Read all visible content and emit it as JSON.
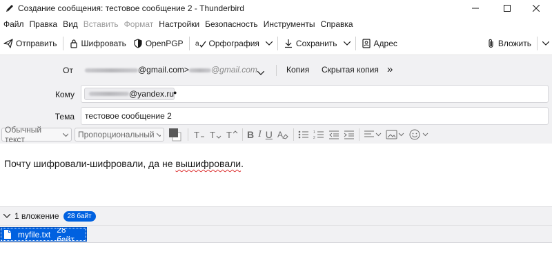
{
  "window": {
    "title": "Создание сообщения: тестовое сообщение 2 - Thunderbird",
    "icon": "pencil-icon"
  },
  "menu": [
    "Файл",
    "Правка",
    "Вид",
    "Вставить",
    "Формат",
    "Настройки",
    "Безопасность",
    "Инструменты",
    "Справка"
  ],
  "menu_disabled": [
    "Вставить",
    "Формат"
  ],
  "toolbar": {
    "send": "Отправить",
    "encrypt": "Шифровать",
    "openpgp": "OpenPGP",
    "spelling": "Орфография",
    "save": "Сохранить",
    "address": "Адрес",
    "attach": "Вложить"
  },
  "headers": {
    "from_label": "От",
    "from_address_visible": "@gmail.com>",
    "from_alias_visible": "@gmail.com",
    "cc": "Копия",
    "bcc": "Скрытая копия",
    "more": "»",
    "to_label": "Кому",
    "to_visible": "@yandex.ru",
    "subject_label": "Тема",
    "subject": "тестовое сообщение 2"
  },
  "format": {
    "paragraph": "Обычный текст",
    "font": "Пропорциональный"
  },
  "body": {
    "text_before": "Почту шифровали-шифровали, да не ",
    "misspelled": "вышифровали",
    "text_after": "."
  },
  "attachments": {
    "summary": "1 вложение",
    "total_size": "28 байт",
    "items": [
      {
        "name": "myfile.txt",
        "size": "28 байт"
      }
    ]
  },
  "colors": {
    "accent": "#0061e0",
    "header_bg": "#f1f1f3",
    "spell_error": "#dd3333"
  }
}
